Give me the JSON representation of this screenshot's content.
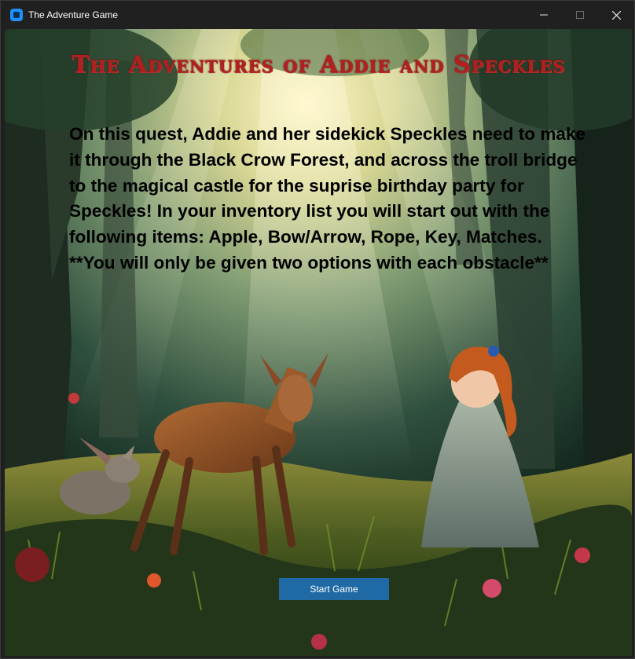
{
  "window": {
    "title": "The Adventure Game",
    "controls": [
      "minimize-icon",
      "maximize-icon",
      "close-icon"
    ]
  },
  "game": {
    "title": "The Adventures of Addie and Speckles",
    "intro": "On this quest, Addie and her sidekick Speckles need to make it through the Black Crow Forest, and across the troll bridge to the magical castle for the suprise birthday party for Speckles! In your inventory list you will start out with the following items: Apple, Bow/Arrow, Rope, Key, Matches. **You will only be given two options with each obstacle**",
    "start_button": "Start Game"
  },
  "colors": {
    "title": "#b02020",
    "button": "#1f6aa5",
    "window_chrome": "#202020"
  }
}
